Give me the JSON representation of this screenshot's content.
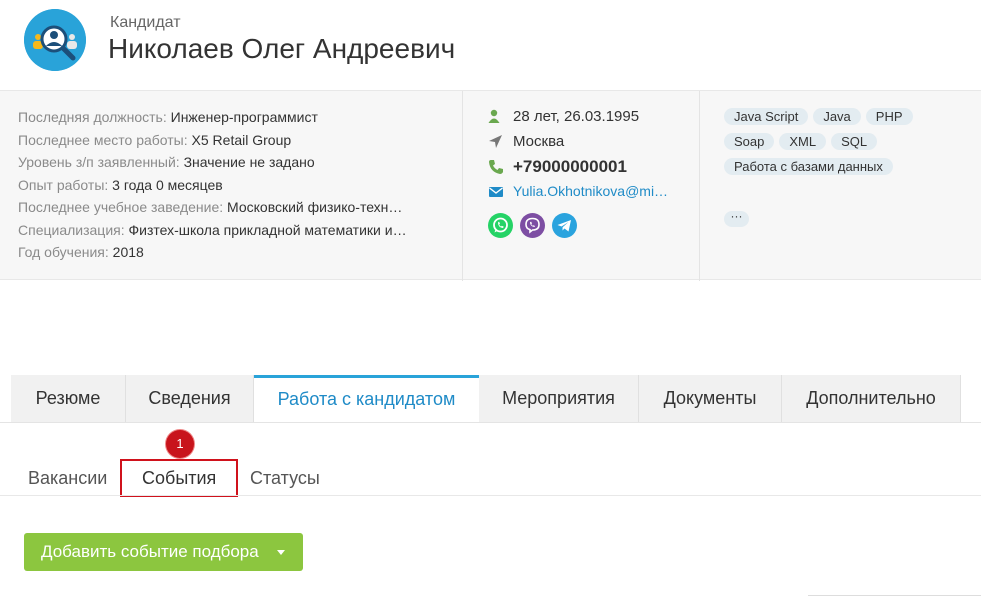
{
  "header": {
    "entity_type": "Кандидат",
    "candidate_name": "Николаев Олег Андреевич"
  },
  "info": {
    "rows": [
      {
        "label": "Последняя должность:",
        "value": "Инженер-программист"
      },
      {
        "label": "Последнее место работы:",
        "value": "X5 Retail Group"
      },
      {
        "label": "Уровень з/п заявленный:",
        "value": "Значение не задано"
      },
      {
        "label": "Опыт работы:",
        "value": "3 года 0 месяцев"
      },
      {
        "label": "Последнее учебное заведение:",
        "value": "Московский физико-техн…"
      },
      {
        "label": "Специализация:",
        "value": "Физтех-школа прикладной математики и…"
      },
      {
        "label": "Год обучения:",
        "value": "2018"
      }
    ]
  },
  "contacts": {
    "age_birthdate": "28 лет, 26.03.1995",
    "city": "Москва",
    "phone": "+79000000001",
    "email": "Yulia.Okhotnikova@mi…",
    "icons": {
      "person": "person-icon",
      "location": "location-arrow-icon",
      "phone": "phone-icon",
      "email": "envelope-icon"
    },
    "messengers": [
      "whatsapp-icon",
      "viber-icon",
      "telegram-icon"
    ]
  },
  "skills": {
    "tags": [
      "Java Script",
      "Java",
      "PHP",
      "Soap",
      "XML",
      "SQL",
      "Работа с базами данных"
    ],
    "more_label": "···"
  },
  "tabs": [
    {
      "label": "Резюме"
    },
    {
      "label": "Сведения"
    },
    {
      "label": "Работа с кандидатом"
    },
    {
      "label": "Мероприятия"
    },
    {
      "label": "Документы"
    },
    {
      "label": "Дополнительно"
    }
  ],
  "subtabs": [
    {
      "label": "Вакансии"
    },
    {
      "label": "События"
    },
    {
      "label": "Статусы"
    }
  ],
  "callout": {
    "number": "1"
  },
  "actions": {
    "add_event_label": "Добавить событие подбора"
  },
  "colors": {
    "accent": "#29a3d9",
    "link": "#1f8bc7",
    "button_green": "#8cc63f",
    "highlight_red": "#d0121c",
    "whatsapp": "#25d366",
    "viber": "#7d4ea3",
    "telegram": "#2aa3de"
  }
}
